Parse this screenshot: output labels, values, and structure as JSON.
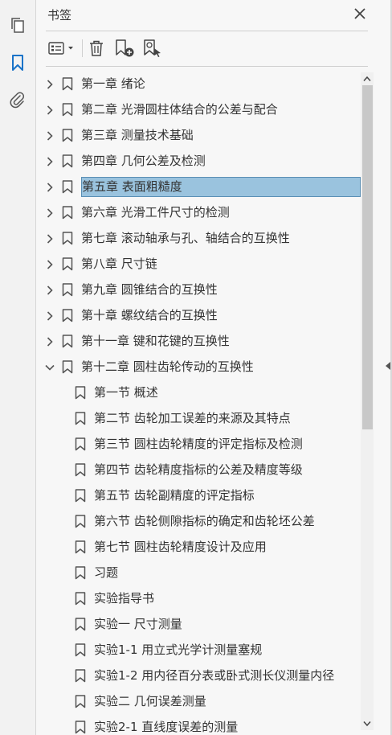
{
  "rail": {
    "pages_icon": "pages-icon",
    "bookmarks_icon": "bookmark-icon",
    "attachments_icon": "paperclip-icon"
  },
  "header": {
    "title": "书签"
  },
  "toolbar": {
    "options": "list-options-icon",
    "delete": "trash-icon",
    "new_bookmark": "new-bookmark-icon",
    "find_bookmark": "find-bookmark-icon"
  },
  "colors": {
    "selection": "#9ac3de",
    "accent": "#1a73c8"
  },
  "bookmarks": [
    {
      "label": "第一章  绪论",
      "level": 0,
      "expand": "collapsed"
    },
    {
      "label": "第二章  光滑圆柱体结合的公差与配合",
      "level": 0,
      "expand": "collapsed"
    },
    {
      "label": "第三章  测量技术基础",
      "level": 0,
      "expand": "collapsed"
    },
    {
      "label": "第四章  几何公差及检测",
      "level": 0,
      "expand": "collapsed"
    },
    {
      "label": "第五章  表面粗糙度",
      "level": 0,
      "expand": "collapsed",
      "selected": true
    },
    {
      "label": "第六章  光滑工件尺寸的检测",
      "level": 0,
      "expand": "collapsed"
    },
    {
      "label": "第七章  滚动轴承与孔、轴结合的互换性",
      "level": 0,
      "expand": "collapsed"
    },
    {
      "label": "第八章  尺寸链",
      "level": 0,
      "expand": "collapsed"
    },
    {
      "label": "第九章  圆锥结合的互换性",
      "level": 0,
      "expand": "collapsed"
    },
    {
      "label": "第十章  螺纹结合的互换性",
      "level": 0,
      "expand": "collapsed"
    },
    {
      "label": "第十一章  键和花键的互换性",
      "level": 0,
      "expand": "collapsed"
    },
    {
      "label": "第十二章  圆柱齿轮传动的互换性",
      "level": 0,
      "expand": "expanded"
    },
    {
      "label": "第一节  概述",
      "level": 1
    },
    {
      "label": "第二节  齿轮加工误差的来源及其特点",
      "level": 1
    },
    {
      "label": "第三节  圆柱齿轮精度的评定指标及检测",
      "level": 1
    },
    {
      "label": "第四节  齿轮精度指标的公差及精度等级",
      "level": 1
    },
    {
      "label": "第五节  齿轮副精度的评定指标",
      "level": 1
    },
    {
      "label": "第六节  齿轮侧隙指标的确定和齿轮坯公差",
      "level": 1
    },
    {
      "label": "第七节  圆柱齿轮精度设计及应用",
      "level": 1
    },
    {
      "label": "习题",
      "level": 1
    },
    {
      "label": "实验指导书",
      "level": 1
    },
    {
      "label": "实验一  尺寸测量",
      "level": 1
    },
    {
      "label": "实验1-1  用立式光学计测量塞规",
      "level": 1
    },
    {
      "label": "实验1-2  用内径百分表或卧式测长仪测量内径",
      "level": 1
    },
    {
      "label": "实验二  几何误差测量",
      "level": 1
    },
    {
      "label": "实验2-1  直线度误差的测量",
      "level": 1
    }
  ],
  "scrollbar": {
    "scroll_fraction": 0.0
  }
}
